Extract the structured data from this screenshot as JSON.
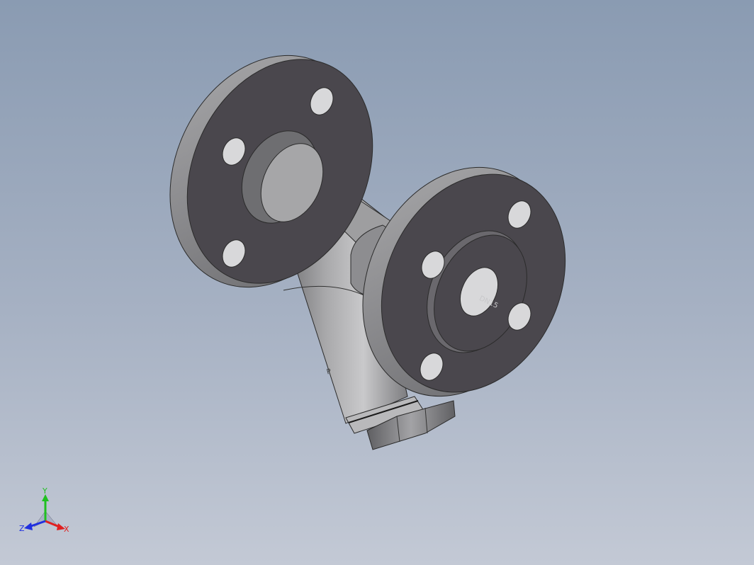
{
  "viewport": {
    "background_top": "#8a9bb2",
    "background_bottom": "#c3c9d5"
  },
  "model": {
    "name": "y-strainer",
    "flange_face_color": "#4a474d",
    "body_color": "#8c8c8c",
    "engraving_main": "DN15",
    "engraving_body": "P"
  },
  "triad": {
    "x_label": "X",
    "y_label": "Y",
    "z_label": "Z",
    "x_color": "#e02020",
    "y_color": "#20c020",
    "z_color": "#2030e0"
  }
}
